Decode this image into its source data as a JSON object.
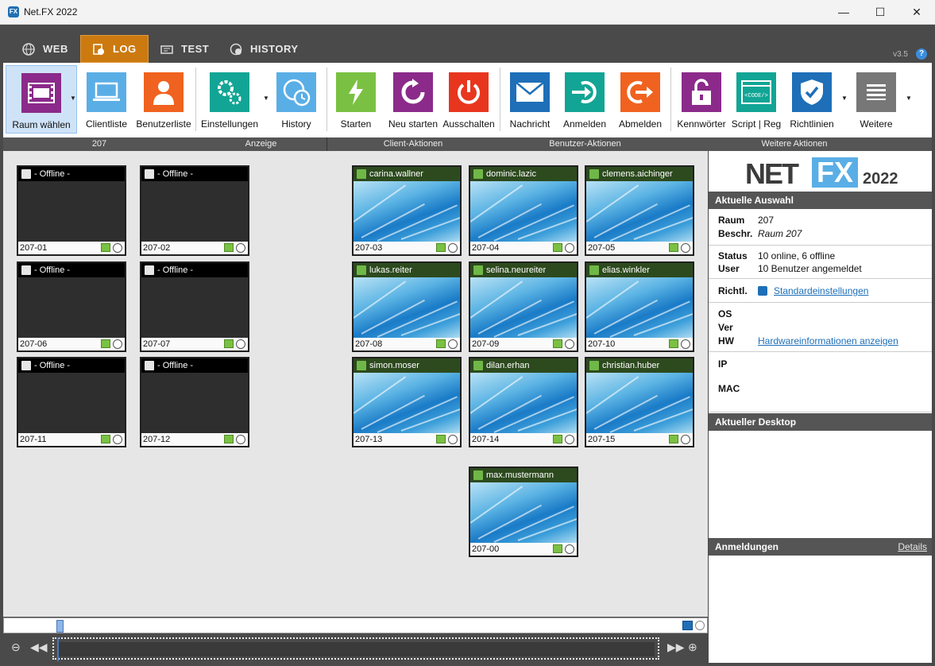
{
  "window": {
    "title": "Net.FX 2022",
    "minimize": "—",
    "maximize": "☐",
    "close": "✕"
  },
  "tabs": [
    {
      "label": "WEB",
      "icon": "globe-icon"
    },
    {
      "label": "LOG",
      "icon": "log-icon"
    },
    {
      "label": "TEST",
      "icon": "test-icon"
    },
    {
      "label": "HISTORY",
      "icon": "history-icon"
    }
  ],
  "version": "v3.5",
  "ribbon": {
    "buttons": [
      {
        "label": "Raum wählen",
        "color": "#8b2a8a",
        "icon": "room-select-icon"
      },
      {
        "label": "Clientliste",
        "color": "#5aaee6",
        "icon": "laptop-icon"
      },
      {
        "label": "Benutzerliste",
        "color": "#f0621f",
        "icon": "user-icon"
      },
      {
        "label": "Einstellungen",
        "color": "#12a595",
        "icon": "gears-icon"
      },
      {
        "label": "History",
        "color": "#5aaee6",
        "icon": "history-globe-icon"
      },
      {
        "label": "Starten",
        "color": "#7ac143",
        "icon": "lightning-icon"
      },
      {
        "label": "Neu starten",
        "color": "#8b2a8a",
        "icon": "restart-icon"
      },
      {
        "label": "Ausschalten",
        "color": "#e8361e",
        "icon": "power-icon"
      },
      {
        "label": "Nachricht",
        "color": "#1e6fb8",
        "icon": "envelope-icon"
      },
      {
        "label": "Anmelden",
        "color": "#12a595",
        "icon": "login-icon"
      },
      {
        "label": "Abmelden",
        "color": "#f0621f",
        "icon": "logout-icon"
      },
      {
        "label": "Kennwörter",
        "color": "#8b2a8a",
        "icon": "lock-icon"
      },
      {
        "label": "Script | Reg",
        "color": "#12a595",
        "icon": "code-icon"
      },
      {
        "label": "Richtlinien",
        "color": "#1e6fb8",
        "icon": "shield-icon"
      },
      {
        "label": "Weitere",
        "color": "#777777",
        "icon": "menu-lines-icon"
      }
    ],
    "groups": [
      "207",
      "Anzeige",
      "Client-Aktionen",
      "Benutzer-Aktionen",
      "Weitere Aktionen"
    ]
  },
  "clients": [
    {
      "name": "- Offline -",
      "id": "207-01",
      "online": false
    },
    {
      "name": "- Offline -",
      "id": "207-02",
      "online": false
    },
    {
      "name": "carina.wallner",
      "id": "207-03",
      "online": true
    },
    {
      "name": "dominic.lazic",
      "id": "207-04",
      "online": true
    },
    {
      "name": "clemens.aichinger",
      "id": "207-05",
      "online": true
    },
    {
      "name": "- Offline -",
      "id": "207-06",
      "online": false
    },
    {
      "name": "- Offline -",
      "id": "207-07",
      "online": false
    },
    {
      "name": "lukas.reiter",
      "id": "207-08",
      "online": true
    },
    {
      "name": "selina.neureiter",
      "id": "207-09",
      "online": true
    },
    {
      "name": "elias.winkler",
      "id": "207-10",
      "online": true
    },
    {
      "name": "- Offline -",
      "id": "207-11",
      "online": false
    },
    {
      "name": "- Offline -",
      "id": "207-12",
      "online": false
    },
    {
      "name": "simon.moser",
      "id": "207-13",
      "online": true
    },
    {
      "name": "dilan.erhan",
      "id": "207-14",
      "online": true
    },
    {
      "name": "christian.huber",
      "id": "207-15",
      "online": true
    },
    {
      "name": "max.mustermann",
      "id": "207-00",
      "online": true
    }
  ],
  "sidebar": {
    "logo": {
      "net": "NET",
      "fx": "FX",
      "year": "2022"
    },
    "selection_header": "Aktuelle Auswahl",
    "raum_label": "Raum",
    "raum_value": "207",
    "beschr_label": "Beschr.",
    "beschr_value": "Raum 207",
    "status_label": "Status",
    "status_value": "10 online, 6 offline",
    "user_label": "User",
    "user_value": "10 Benutzer angemeldet",
    "richtl_label": "Richtl.",
    "richtl_value": "Standardeinstellungen",
    "os_label": "OS",
    "ver_label": "Ver",
    "hw_label": "HW",
    "hw_value": "Hardwareinformationen anzeigen",
    "ip_label": "IP",
    "mac_label": "MAC",
    "desktop_header": "Aktueller Desktop",
    "logins_header": "Anmeldungen",
    "logins_details": "Details"
  }
}
